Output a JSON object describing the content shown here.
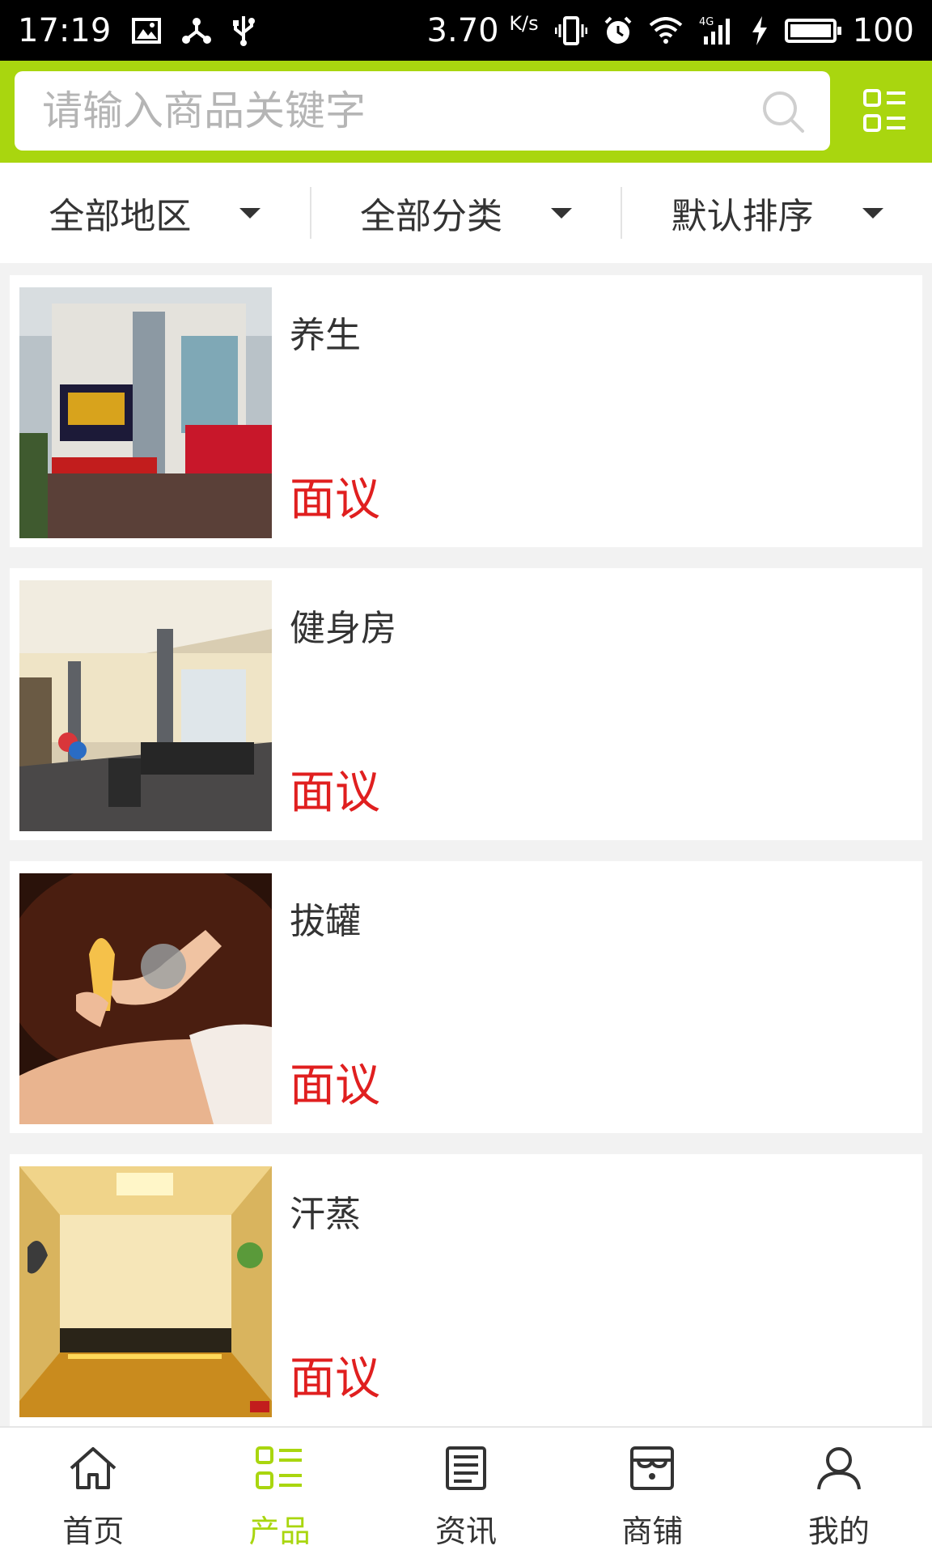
{
  "status_bar": {
    "time": "17:19",
    "speed": "3.70",
    "speed_unit": "K/s",
    "battery": "100",
    "icons": [
      "image-icon",
      "network-share-icon",
      "usb-icon",
      "vibrate-icon",
      "alarm-icon",
      "wifi-icon",
      "signal-4g-icon",
      "charging-icon",
      "battery-icon"
    ]
  },
  "search": {
    "placeholder": "请输入商品关键字",
    "value": ""
  },
  "filters": [
    {
      "label": "全部地区"
    },
    {
      "label": "全部分类"
    },
    {
      "label": "默认排序"
    }
  ],
  "products": [
    {
      "name": "养生",
      "price": "面议"
    },
    {
      "name": "健身房",
      "price": "面议"
    },
    {
      "name": "拔罐",
      "price": "面议"
    },
    {
      "name": "汗蒸",
      "price": "面议"
    }
  ],
  "bottom_nav": [
    {
      "label": "首页",
      "icon": "home-icon"
    },
    {
      "label": "产品",
      "icon": "product-list-icon",
      "active": true
    },
    {
      "label": "资讯",
      "icon": "news-icon"
    },
    {
      "label": "商铺",
      "icon": "shop-icon"
    },
    {
      "label": "我的",
      "icon": "user-icon"
    }
  ],
  "colors": {
    "accent": "#a9d60f",
    "price": "#e01f1f",
    "text": "#333333"
  }
}
